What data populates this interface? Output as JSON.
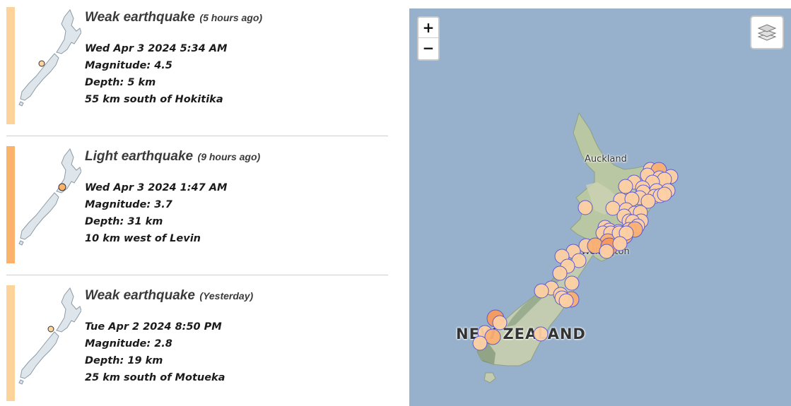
{
  "quakes": [
    {
      "strength": "Weak earthquake",
      "ago": "(5 hours ago)",
      "datetime": "Wed Apr 3 2024 5:34 AM",
      "magnitude": "Magnitude: 4.5",
      "depth": "Depth: 5 km",
      "location": "55 km south of Hokitika",
      "accent_color": "#fdd39c"
    },
    {
      "strength": "Light earthquake",
      "ago": "(9 hours ago)",
      "datetime": "Wed Apr 3 2024 1:47 AM",
      "magnitude": "Magnitude: 3.7",
      "depth": "Depth: 31 km",
      "location": "10 km west of Levin",
      "accent_color": "#fbb26c"
    },
    {
      "strength": "Weak earthquake",
      "ago": "(Yesterday)",
      "datetime": "Tue Apr 2 2024 8:50 PM",
      "magnitude": "Magnitude: 2.8",
      "depth": "Depth: 19 km",
      "location": "25 km south of Motueka",
      "accent_color": "#fdd39c"
    }
  ],
  "map": {
    "zoom_in_label": "+",
    "zoom_out_label": "−",
    "labels": {
      "auckland": "Auckland",
      "wellington": "Wellington",
      "country": "NEW ZEALAND"
    },
    "colors": {
      "sea": "#97b1cc",
      "marker_weak": "#fdd0a4",
      "marker_light": "#fbb072",
      "marker_moderate": "#f79a5c",
      "marker_border": "#5b5bd6"
    }
  }
}
